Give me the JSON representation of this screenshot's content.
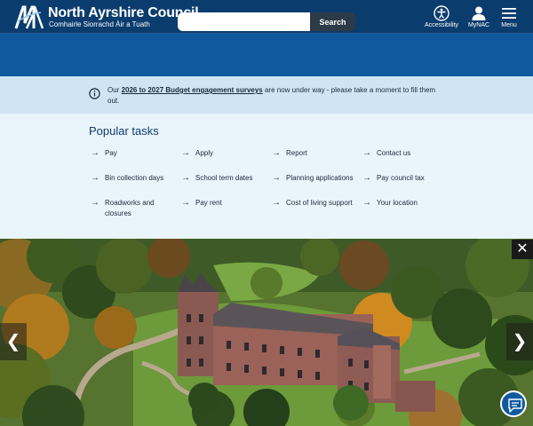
{
  "header": {
    "brand_name": "North Ayrshire Council",
    "brand_subtitle": "Comhairle Siorrachd Àir a Tuath",
    "accessibility_label": "Accessibility",
    "mynac_label": "MyNAC",
    "menu_label": "Menu",
    "icons": {
      "logo": "north-ayrshire-logo",
      "accessibility": "accessibility-person-icon",
      "mynac": "user-icon",
      "menu": "hamburger-menu-icon"
    },
    "background": "#0b3c6e"
  },
  "search": {
    "placeholder": "",
    "button_label": "Search",
    "background": "#0f5a9e"
  },
  "notice": {
    "icon": "info-icon",
    "text_before": "Our ",
    "link_text": "2026 to 2027 Budget engagement surveys",
    "text_after": " are now under way - please take a moment to fill them out."
  },
  "popular_tasks": {
    "title": "Popular tasks",
    "arrow_icon": "arrow-right-icon",
    "items": [
      {
        "label": "Pay"
      },
      {
        "label": "Apply"
      },
      {
        "label": "Report"
      },
      {
        "label": "Contact us"
      },
      {
        "label": "Bin collection days"
      },
      {
        "label": "School term dates"
      },
      {
        "label": "Planning applications"
      },
      {
        "label": "Pay council tax"
      },
      {
        "label": "Roadworks and closures"
      },
      {
        "label": "Pay rent"
      },
      {
        "label": "Cost of living support"
      },
      {
        "label": "Your location"
      }
    ]
  },
  "hero": {
    "close_label": "✕",
    "prev_label": "❮",
    "next_label": "❯",
    "icons": {
      "close": "close-icon",
      "prev": "chevron-left-icon",
      "next": "chevron-right-icon",
      "chat": "chat-icon"
    }
  }
}
